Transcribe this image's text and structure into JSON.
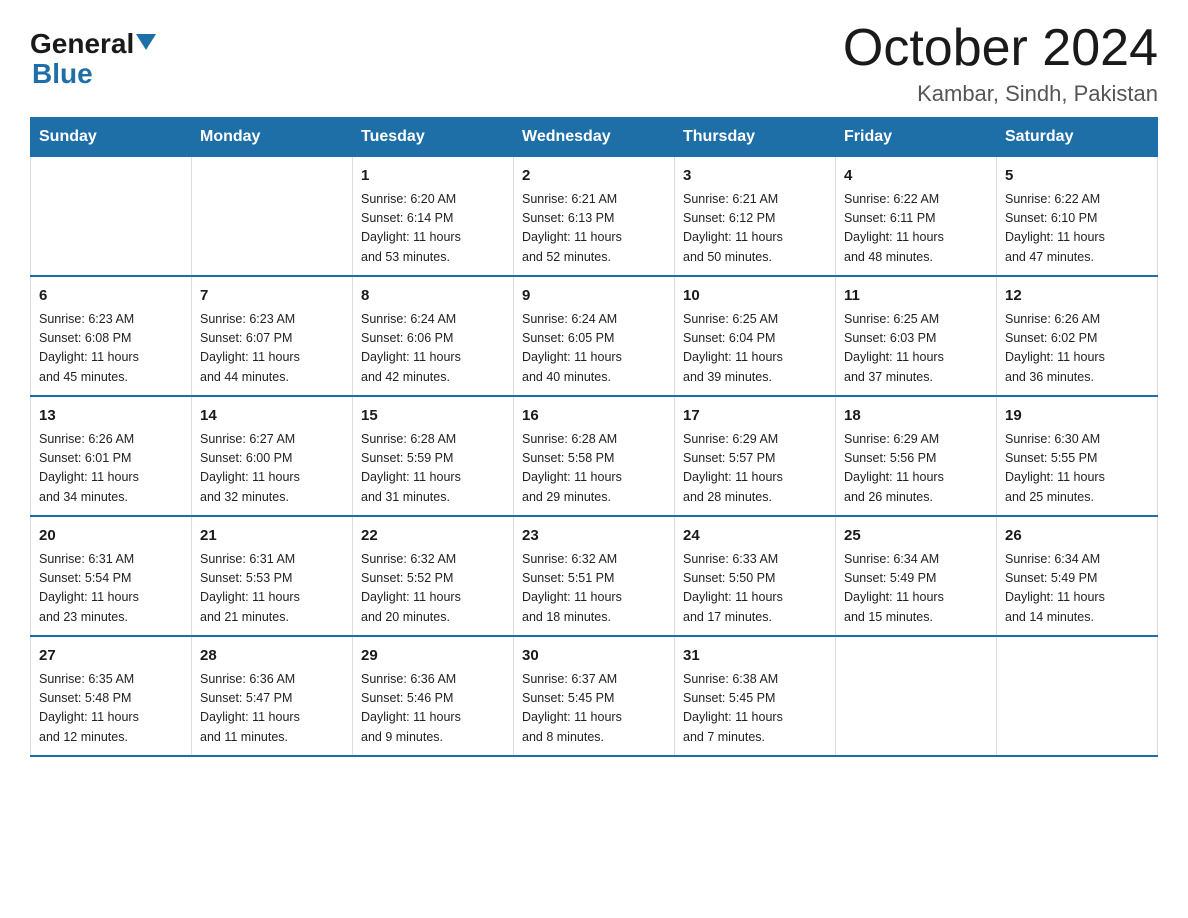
{
  "logo": {
    "general": "General",
    "arrow": "▼",
    "blue": "Blue"
  },
  "title": "October 2024",
  "subtitle": "Kambar, Sindh, Pakistan",
  "weekdays": [
    "Sunday",
    "Monday",
    "Tuesday",
    "Wednesday",
    "Thursday",
    "Friday",
    "Saturday"
  ],
  "weeks": [
    [
      {
        "day": "",
        "info": ""
      },
      {
        "day": "",
        "info": ""
      },
      {
        "day": "1",
        "info": "Sunrise: 6:20 AM\nSunset: 6:14 PM\nDaylight: 11 hours\nand 53 minutes."
      },
      {
        "day": "2",
        "info": "Sunrise: 6:21 AM\nSunset: 6:13 PM\nDaylight: 11 hours\nand 52 minutes."
      },
      {
        "day": "3",
        "info": "Sunrise: 6:21 AM\nSunset: 6:12 PM\nDaylight: 11 hours\nand 50 minutes."
      },
      {
        "day": "4",
        "info": "Sunrise: 6:22 AM\nSunset: 6:11 PM\nDaylight: 11 hours\nand 48 minutes."
      },
      {
        "day": "5",
        "info": "Sunrise: 6:22 AM\nSunset: 6:10 PM\nDaylight: 11 hours\nand 47 minutes."
      }
    ],
    [
      {
        "day": "6",
        "info": "Sunrise: 6:23 AM\nSunset: 6:08 PM\nDaylight: 11 hours\nand 45 minutes."
      },
      {
        "day": "7",
        "info": "Sunrise: 6:23 AM\nSunset: 6:07 PM\nDaylight: 11 hours\nand 44 minutes."
      },
      {
        "day": "8",
        "info": "Sunrise: 6:24 AM\nSunset: 6:06 PM\nDaylight: 11 hours\nand 42 minutes."
      },
      {
        "day": "9",
        "info": "Sunrise: 6:24 AM\nSunset: 6:05 PM\nDaylight: 11 hours\nand 40 minutes."
      },
      {
        "day": "10",
        "info": "Sunrise: 6:25 AM\nSunset: 6:04 PM\nDaylight: 11 hours\nand 39 minutes."
      },
      {
        "day": "11",
        "info": "Sunrise: 6:25 AM\nSunset: 6:03 PM\nDaylight: 11 hours\nand 37 minutes."
      },
      {
        "day": "12",
        "info": "Sunrise: 6:26 AM\nSunset: 6:02 PM\nDaylight: 11 hours\nand 36 minutes."
      }
    ],
    [
      {
        "day": "13",
        "info": "Sunrise: 6:26 AM\nSunset: 6:01 PM\nDaylight: 11 hours\nand 34 minutes."
      },
      {
        "day": "14",
        "info": "Sunrise: 6:27 AM\nSunset: 6:00 PM\nDaylight: 11 hours\nand 32 minutes."
      },
      {
        "day": "15",
        "info": "Sunrise: 6:28 AM\nSunset: 5:59 PM\nDaylight: 11 hours\nand 31 minutes."
      },
      {
        "day": "16",
        "info": "Sunrise: 6:28 AM\nSunset: 5:58 PM\nDaylight: 11 hours\nand 29 minutes."
      },
      {
        "day": "17",
        "info": "Sunrise: 6:29 AM\nSunset: 5:57 PM\nDaylight: 11 hours\nand 28 minutes."
      },
      {
        "day": "18",
        "info": "Sunrise: 6:29 AM\nSunset: 5:56 PM\nDaylight: 11 hours\nand 26 minutes."
      },
      {
        "day": "19",
        "info": "Sunrise: 6:30 AM\nSunset: 5:55 PM\nDaylight: 11 hours\nand 25 minutes."
      }
    ],
    [
      {
        "day": "20",
        "info": "Sunrise: 6:31 AM\nSunset: 5:54 PM\nDaylight: 11 hours\nand 23 minutes."
      },
      {
        "day": "21",
        "info": "Sunrise: 6:31 AM\nSunset: 5:53 PM\nDaylight: 11 hours\nand 21 minutes."
      },
      {
        "day": "22",
        "info": "Sunrise: 6:32 AM\nSunset: 5:52 PM\nDaylight: 11 hours\nand 20 minutes."
      },
      {
        "day": "23",
        "info": "Sunrise: 6:32 AM\nSunset: 5:51 PM\nDaylight: 11 hours\nand 18 minutes."
      },
      {
        "day": "24",
        "info": "Sunrise: 6:33 AM\nSunset: 5:50 PM\nDaylight: 11 hours\nand 17 minutes."
      },
      {
        "day": "25",
        "info": "Sunrise: 6:34 AM\nSunset: 5:49 PM\nDaylight: 11 hours\nand 15 minutes."
      },
      {
        "day": "26",
        "info": "Sunrise: 6:34 AM\nSunset: 5:49 PM\nDaylight: 11 hours\nand 14 minutes."
      }
    ],
    [
      {
        "day": "27",
        "info": "Sunrise: 6:35 AM\nSunset: 5:48 PM\nDaylight: 11 hours\nand 12 minutes."
      },
      {
        "day": "28",
        "info": "Sunrise: 6:36 AM\nSunset: 5:47 PM\nDaylight: 11 hours\nand 11 minutes."
      },
      {
        "day": "29",
        "info": "Sunrise: 6:36 AM\nSunset: 5:46 PM\nDaylight: 11 hours\nand 9 minutes."
      },
      {
        "day": "30",
        "info": "Sunrise: 6:37 AM\nSunset: 5:45 PM\nDaylight: 11 hours\nand 8 minutes."
      },
      {
        "day": "31",
        "info": "Sunrise: 6:38 AM\nSunset: 5:45 PM\nDaylight: 11 hours\nand 7 minutes."
      },
      {
        "day": "",
        "info": ""
      },
      {
        "day": "",
        "info": ""
      }
    ]
  ]
}
